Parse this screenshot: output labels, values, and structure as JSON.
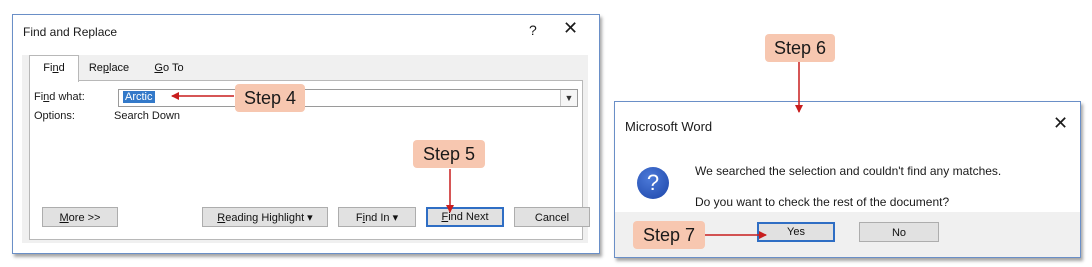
{
  "find_replace": {
    "title": "Find and Replace",
    "help": "?",
    "close": "✕",
    "tabs": [
      {
        "pre": "Fi",
        "acc": "n",
        "post": "d"
      },
      {
        "pre": "Re",
        "acc": "p",
        "post": "lace"
      },
      {
        "pre": "",
        "acc": "G",
        "post": "o To"
      }
    ],
    "find_label": {
      "pre": "Fi",
      "acc": "n",
      "post": "d what:"
    },
    "find_value": "Arctic",
    "dropdown_glyph": "▼",
    "options_label": "Options:",
    "options_value": "Search Down",
    "buttons": {
      "more": {
        "acc": "M",
        "post": "ore >>"
      },
      "reading_highlight": {
        "acc": "R",
        "post": "eading Highlight ▾"
      },
      "find_in": {
        "pre": "F",
        "acc": "i",
        "post": "nd In ▾"
      },
      "find_next": {
        "acc": "F",
        "post": "ind Next"
      },
      "cancel": "Cancel"
    }
  },
  "message_box": {
    "title": "Microsoft Word",
    "close": "✕",
    "icon": "?",
    "line1": "We searched the selection and couldn't find any matches.",
    "line2": "Do you want to check the rest of the document?",
    "yes": "Yes",
    "no": "No"
  },
  "callouts": {
    "step4": "Step 4",
    "step5": "Step 5",
    "step6": "Step 6",
    "step7": "Step 7"
  },
  "colors": {
    "callout_bg": "#f7c7b0",
    "arrow": "#c81e1e",
    "default_button_border": "#2f6ec4"
  }
}
